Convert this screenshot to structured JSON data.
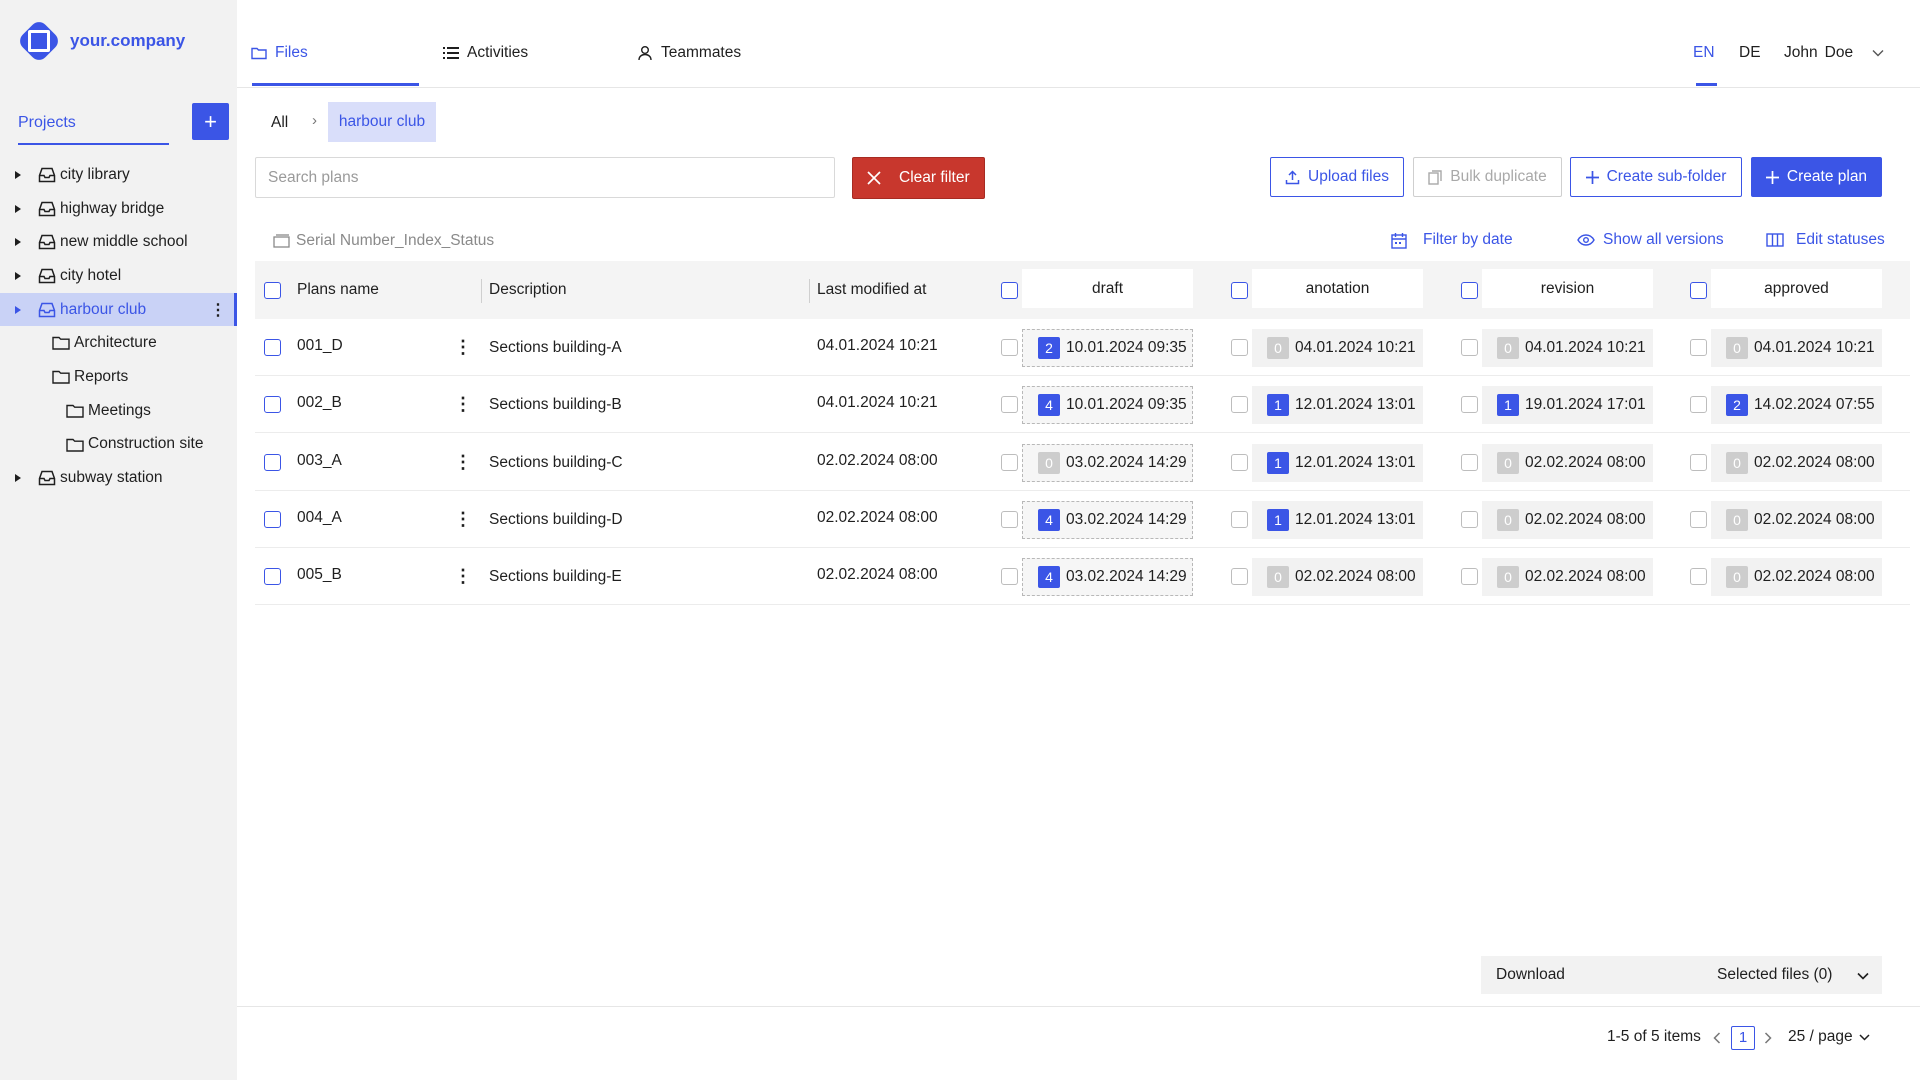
{
  "brand": {
    "name": "your.company",
    "color": "#3b55e6"
  },
  "sidebar": {
    "projects_tab": "Projects",
    "add_label": "+",
    "tree": [
      {
        "label": "city library",
        "level": 0,
        "type": "project",
        "caret": true
      },
      {
        "label": "highway bridge",
        "level": 0,
        "type": "project",
        "caret": true
      },
      {
        "label": "new middle school",
        "level": 0,
        "type": "project",
        "caret": true
      },
      {
        "label": "city hotel",
        "level": 0,
        "type": "project",
        "caret": true
      },
      {
        "label": "harbour club",
        "level": 0,
        "type": "project",
        "caret": true,
        "active": true
      },
      {
        "label": "Architecture",
        "level": 1,
        "type": "folder"
      },
      {
        "label": "Reports",
        "level": 1,
        "type": "folder"
      },
      {
        "label": "Meetings",
        "level": 2,
        "type": "folder"
      },
      {
        "label": "Construction site",
        "level": 2,
        "type": "folder"
      },
      {
        "label": "subway station",
        "level": 0,
        "type": "project",
        "caret": true
      }
    ]
  },
  "topnav": {
    "tabs": [
      {
        "label": "Files",
        "icon": "folder-icon",
        "active": true
      },
      {
        "label": "Activities",
        "icon": "list-icon"
      },
      {
        "label": "Teammates",
        "icon": "user-icon"
      }
    ],
    "lang_en": "EN",
    "lang_de": "DE",
    "user_first": "John",
    "user_last": "Doe"
  },
  "breadcrumb": {
    "root": "All",
    "separator": "›",
    "current": "harbour club"
  },
  "toolbar": {
    "search_placeholder": "Search plans",
    "clear_filter": "Clear filter",
    "upload": "Upload files",
    "bulk_duplicate": "Bulk duplicate",
    "create_subfolder": "Create sub-folder",
    "create_plan": "Create plan"
  },
  "subbar": {
    "serial": "Serial Number_Index_Status",
    "filter_date": "Filter by date",
    "show_versions": "Show all versions",
    "edit_statuses": "Edit statuses"
  },
  "table": {
    "columns": {
      "name": "Plans name",
      "description": "Description",
      "modified": "Last modified at"
    },
    "statuses": [
      "draft",
      "anotation",
      "revision",
      "approved"
    ],
    "rows": [
      {
        "name": "001_D",
        "description": "Sections building-A",
        "modified": "04.01.2024 10:21",
        "status": [
          {
            "count": "2",
            "date": "10.01.2024 09:35"
          },
          {
            "count": "0",
            "date": "04.01.2024 10:21"
          },
          {
            "count": "0",
            "date": "04.01.2024 10:21"
          },
          {
            "count": "0",
            "date": "04.01.2024 10:21"
          }
        ]
      },
      {
        "name": "002_B",
        "description": "Sections building-B",
        "modified": "04.01.2024 10:21",
        "status": [
          {
            "count": "4",
            "date": "10.01.2024 09:35"
          },
          {
            "count": "1",
            "date": "12.01.2024 13:01"
          },
          {
            "count": "1",
            "date": "19.01.2024 17:01"
          },
          {
            "count": "2",
            "date": "14.02.2024 07:55"
          }
        ]
      },
      {
        "name": "003_A",
        "description": "Sections building-C",
        "modified": "02.02.2024 08:00",
        "status": [
          {
            "count": "0",
            "date": "03.02.2024 14:29"
          },
          {
            "count": "1",
            "date": "12.01.2024 13:01"
          },
          {
            "count": "0",
            "date": "02.02.2024 08:00"
          },
          {
            "count": "0",
            "date": "02.02.2024 08:00"
          }
        ]
      },
      {
        "name": "004_A",
        "description": "Sections building-D",
        "modified": "02.02.2024 08:00",
        "status": [
          {
            "count": "4",
            "date": "03.02.2024 14:29"
          },
          {
            "count": "1",
            "date": "12.01.2024 13:01"
          },
          {
            "count": "0",
            "date": "02.02.2024 08:00"
          },
          {
            "count": "0",
            "date": "02.02.2024 08:00"
          }
        ]
      },
      {
        "name": "005_B",
        "description": "Sections building-E",
        "modified": "02.02.2024 08:00",
        "status": [
          {
            "count": "4",
            "date": "03.02.2024 14:29"
          },
          {
            "count": "0",
            "date": "02.02.2024 08:00"
          },
          {
            "count": "0",
            "date": "02.02.2024 08:00"
          },
          {
            "count": "0",
            "date": "02.02.2024 08:00"
          }
        ]
      }
    ]
  },
  "download": {
    "label": "Download",
    "selected": "Selected files (0)"
  },
  "pagination": {
    "summary": "1-5 of 5 items",
    "page": "1",
    "per_page": "25 / page"
  }
}
